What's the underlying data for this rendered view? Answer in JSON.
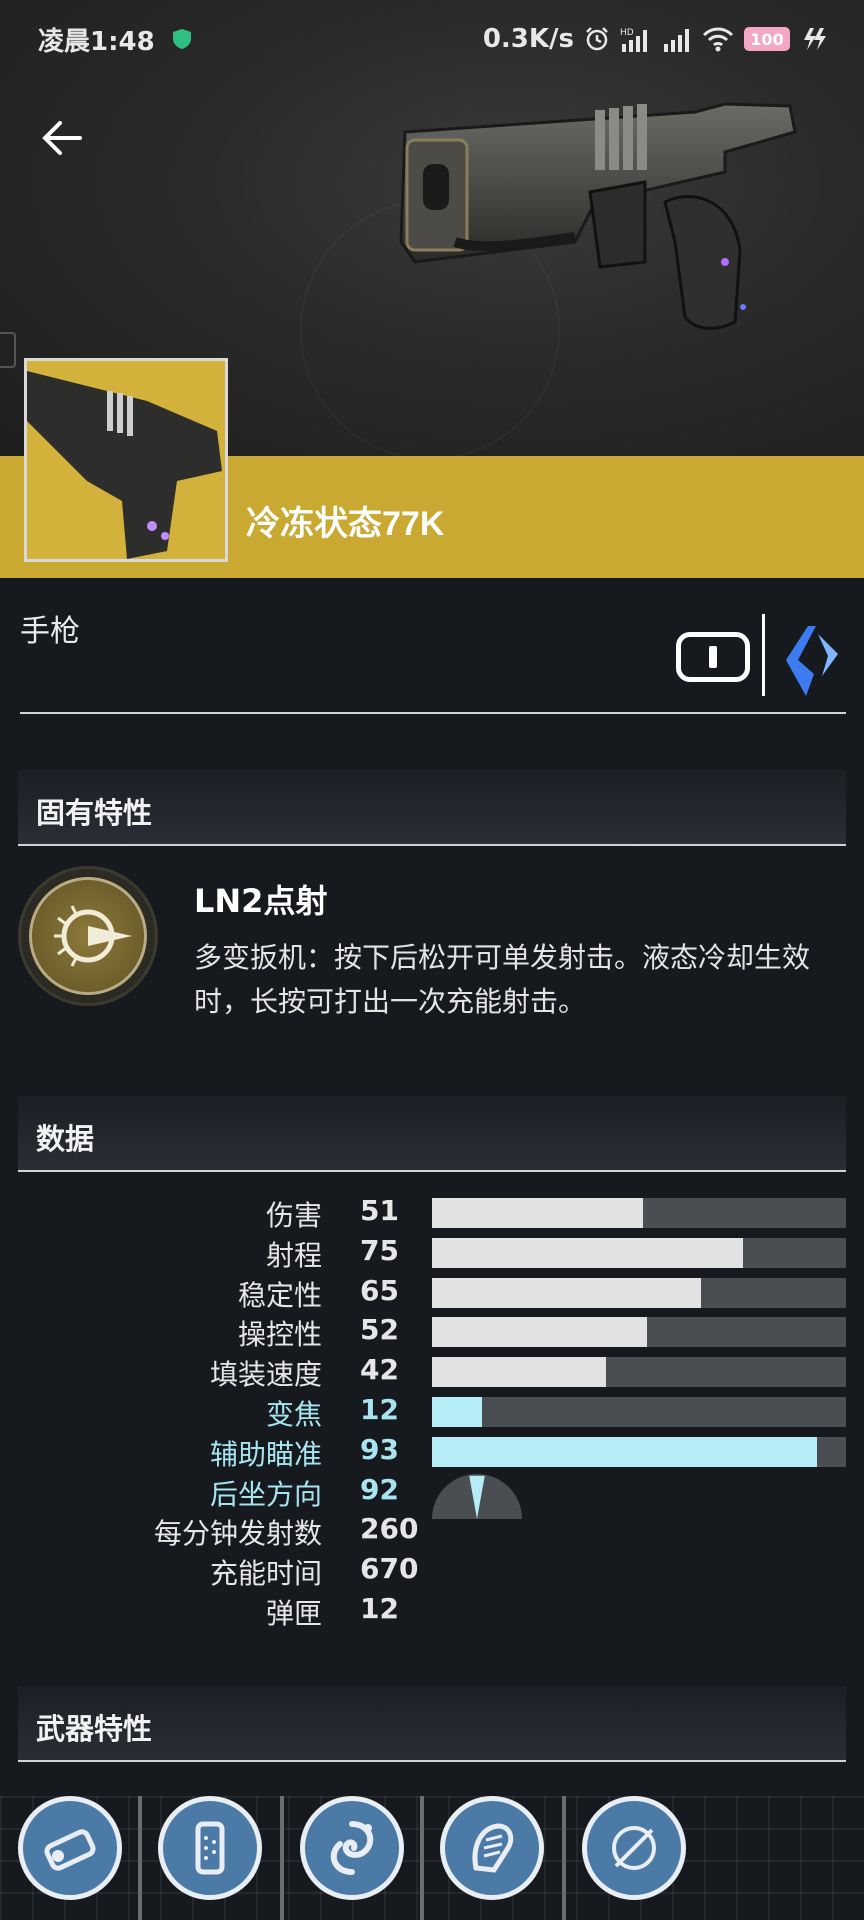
{
  "status_bar": {
    "time": "凌晨1:48",
    "net_speed": "0.3K/s",
    "battery": "100",
    "hd_label": "HD"
  },
  "header": {
    "back_icon": "arrow-left-icon"
  },
  "weapon": {
    "name": "冷冻状态77K",
    "type": "手枪",
    "ammo_icon": "primary-ammo-icon",
    "element_icon": "arc-element-icon",
    "band_color": "#c9a931"
  },
  "sections": {
    "intrinsic": "固有特性",
    "stats": "数据",
    "traits": "武器特性"
  },
  "intrinsic_perk": {
    "icon": "ln2-burst-icon",
    "title": "LN2点射",
    "description": "多变扳机：按下后松开可单发射击。液态冷却生效时，长按可打出一次充能射击。"
  },
  "stats": [
    {
      "label": "伤害",
      "value": "51",
      "bar": 51,
      "highlight": false
    },
    {
      "label": "射程",
      "value": "75",
      "bar": 75,
      "highlight": false
    },
    {
      "label": "稳定性",
      "value": "65",
      "bar": 65,
      "highlight": false
    },
    {
      "label": "操控性",
      "value": "52",
      "bar": 52,
      "highlight": false
    },
    {
      "label": "填装速度",
      "value": "42",
      "bar": 42,
      "highlight": false
    },
    {
      "label": "变焦",
      "value": "12",
      "bar": 12,
      "highlight": true
    },
    {
      "label": "辅助瞄准",
      "value": "93",
      "bar": 93,
      "highlight": true
    },
    {
      "label": "后坐方向",
      "value": "92",
      "bar": null,
      "highlight": true
    },
    {
      "label": "每分钟发射数",
      "value": "260",
      "bar": null,
      "highlight": false
    },
    {
      "label": "充能时间",
      "value": "670",
      "bar": null,
      "highlight": false
    },
    {
      "label": "弹匣",
      "value": "12",
      "bar": null,
      "highlight": false
    }
  ],
  "traits": [
    {
      "icon": "barrel-icon"
    },
    {
      "icon": "magazine-icon"
    },
    {
      "icon": "swirl-perk-icon"
    },
    {
      "icon": "grip-perk-icon"
    },
    {
      "icon": "empty-socket-icon"
    }
  ],
  "colors": {
    "accent_cyan": "#a8e4f0",
    "bar_fill": "#e2e2e2",
    "bar_track": "#4a4d51",
    "trait_blue": "#4b7aa6"
  }
}
